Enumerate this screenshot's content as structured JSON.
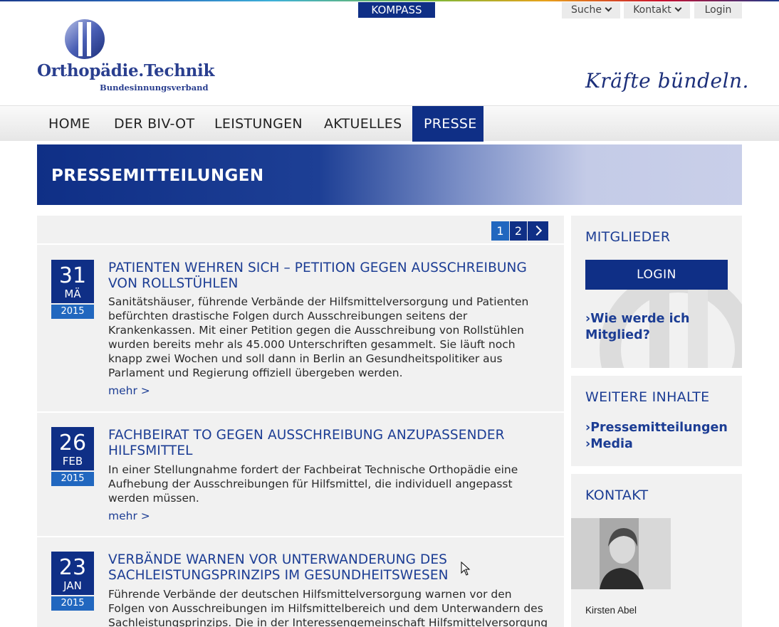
{
  "topbar": {
    "kompass": "KOMPASS",
    "search_label": "Suche",
    "contact_label": "Kontakt",
    "login_label": "Login"
  },
  "logo": {
    "title": "Orthopädie.Technik",
    "subtitle": "Bundesinnungsverband"
  },
  "slogan": "Kräfte bündeln.",
  "nav": {
    "items": [
      {
        "label": "HOME"
      },
      {
        "label": "DER BIV-OT"
      },
      {
        "label": "LEISTUNGEN"
      },
      {
        "label": "AKTUELLES"
      },
      {
        "label": "PRESSE"
      }
    ],
    "active": "PRESSE"
  },
  "banner": {
    "title": "PRESSEMITTEILUNGEN"
  },
  "pagination": {
    "pages": [
      "1",
      "2"
    ],
    "current": "1",
    "next_icon": "chevron-right-icon"
  },
  "articles": [
    {
      "day": "31",
      "month": "MÄ",
      "year": "2015",
      "title": "PATIENTEN WEHREN SICH – PETITION GEGEN AUSSCHREIBUNG VON ROLLSTÜHLEN",
      "text": "Sanitätshäuser, führende Verbände der Hilfsmittelversorgung und Patienten befürchten drastische Folgen durch Ausschreibungen seitens der Krankenkassen. Mit einer Petition gegen die Ausschreibung von Rollstühlen wurden bereits mehr als 45.000 Unterschriften gesammelt. Sie läuft noch knapp zwei Wochen und soll dann in Berlin an Gesundheitspolitiker aus Parlament und Regierung offiziell übergeben werden.",
      "more": "mehr >"
    },
    {
      "day": "26",
      "month": "FEB",
      "year": "2015",
      "title": "FACHBEIRAT TO GEGEN AUSSCHREIBUNG ANZUPASSENDER HILFSMITTEL",
      "text": "In einer Stellungnahme fordert der Fachbeirat Technische Orthopädie eine Aufhebung der Ausschreibungen für Hilfsmittel, die individuell angepasst werden müssen.",
      "more": "mehr >"
    },
    {
      "day": "23",
      "month": "JAN",
      "year": "2015",
      "title": "VERBÄNDE WARNEN VOR UNTERWANDERUNG DES SACHLEISTUNGSPRINZIPS IM GESUNDHEITSWESEN",
      "text": "Führende Verbände der deutschen Hilfsmittelversorgung warnen vor den Folgen von Ausschreibungen im Hilfsmittelbereich und dem Unterwandern des Sachleistungsprinzips. Die in der Interessengemeinschaft Hilfsmittelversorgung",
      "more": ""
    }
  ],
  "sidebar": {
    "members": {
      "heading": "MITGLIEDER",
      "login_button": "LOGIN",
      "link": "›Wie werde ich Mitglied?"
    },
    "more_content": {
      "heading": "WEITERE INHALTE",
      "links": [
        "›Pressemitteilungen",
        "›Media"
      ]
    },
    "contact": {
      "heading": "KONTAKT",
      "name": "Kirsten Abel"
    }
  },
  "colors": {
    "primary": "#0f2f86",
    "accent": "#2167bf",
    "link": "#1c3d94",
    "panel": "#f1f1f1"
  }
}
